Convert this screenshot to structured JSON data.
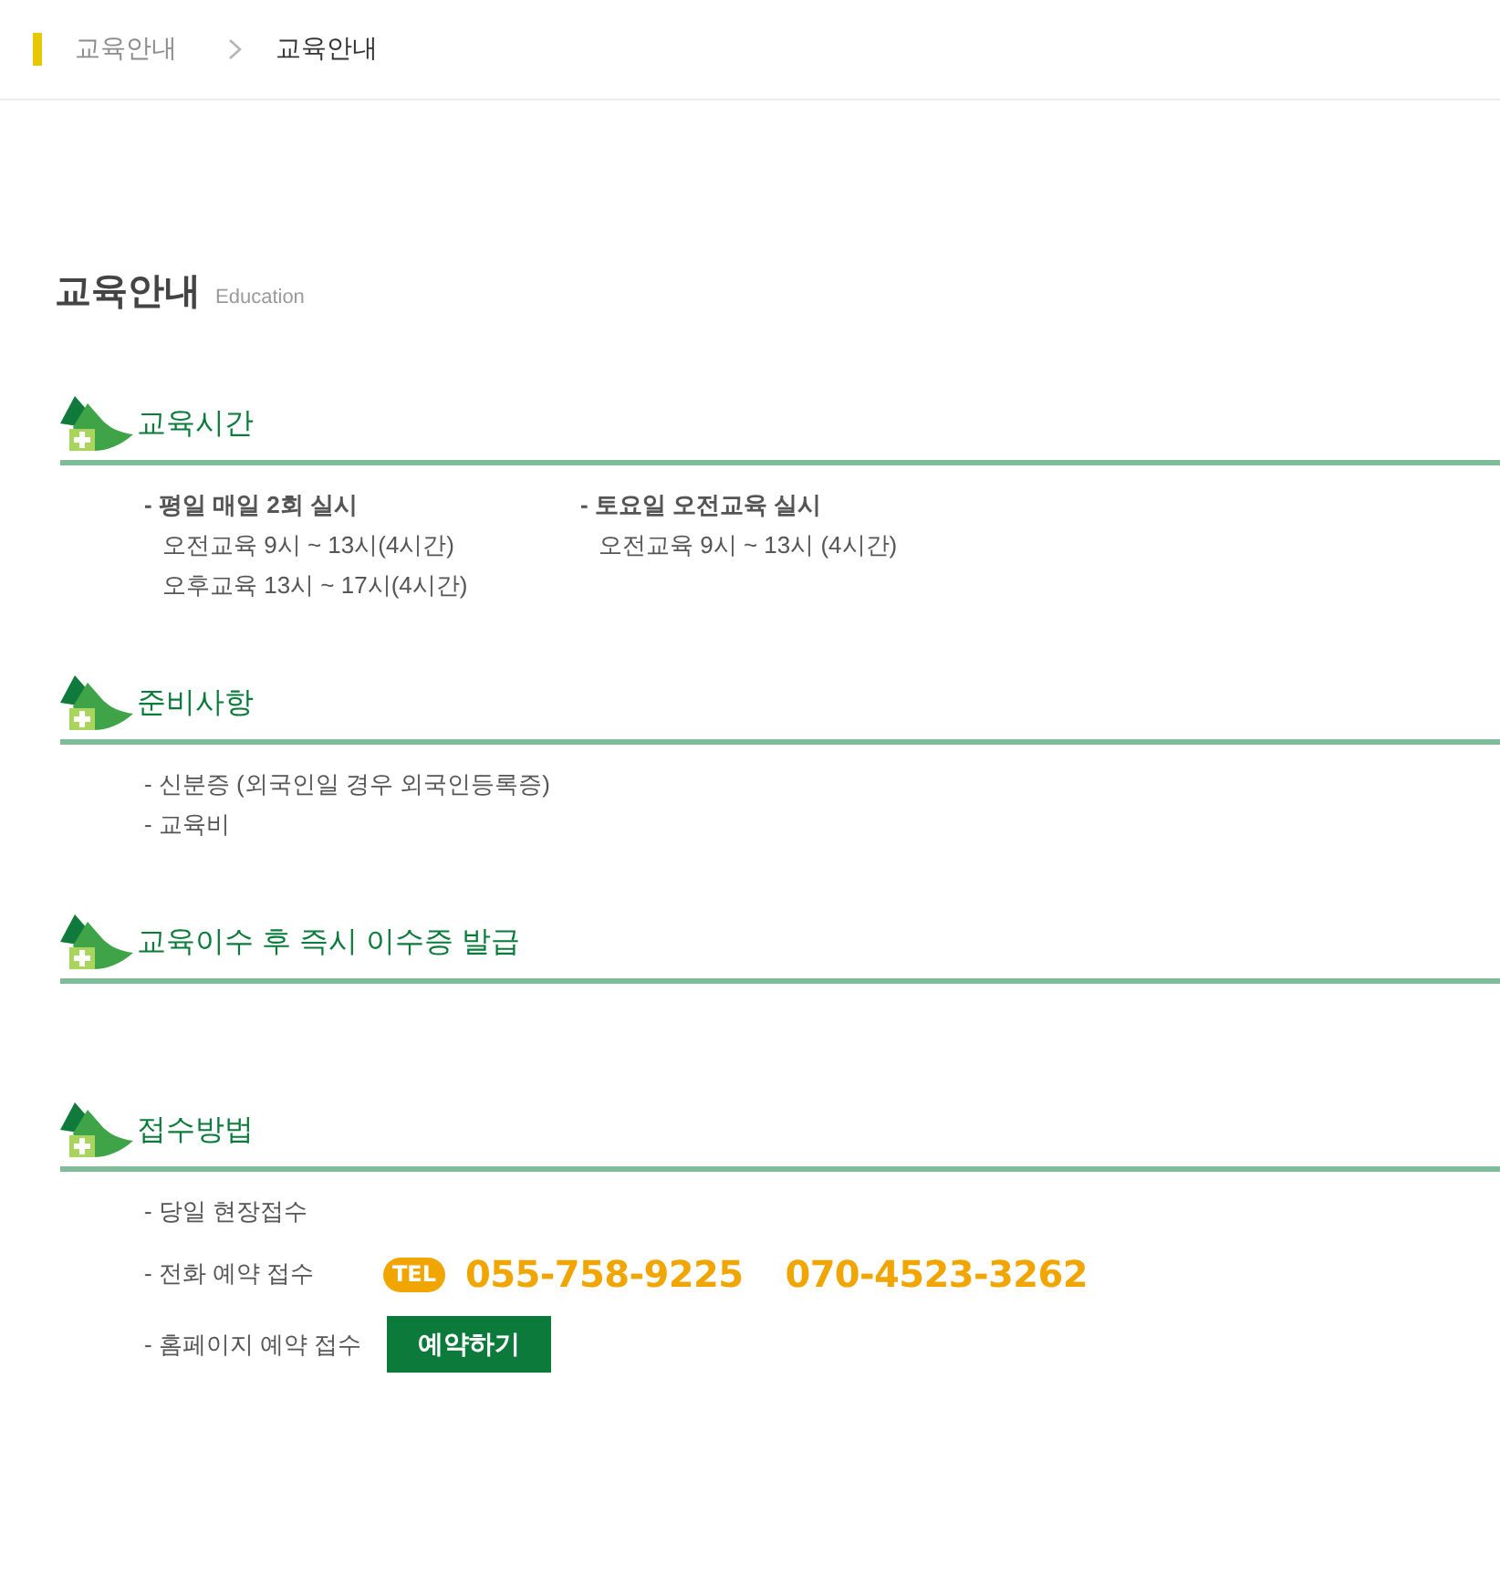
{
  "breadcrumb": {
    "items": [
      {
        "label": "교육안내",
        "current": false
      },
      {
        "label": "교육안내",
        "current": true
      }
    ]
  },
  "page_header": {
    "title": "교육안내",
    "subtitle": "Education"
  },
  "sections": [
    {
      "title": "교육시간",
      "columns": [
        {
          "items": [
            {
              "kind": "heading",
              "text": "- 평일 매일 2회 실시"
            },
            {
              "kind": "detail",
              "text": "오전교육 9시 ~ 13시(4시간)"
            },
            {
              "kind": "detail",
              "text": "오후교육 13시 ~ 17시(4시간)"
            }
          ]
        },
        {
          "items": [
            {
              "kind": "heading",
              "text": "- 토요일 오전교육 실시"
            },
            {
              "kind": "detail",
              "text": "오전교육 9시 ~ 13시 (4시간)"
            }
          ]
        }
      ]
    },
    {
      "title": "준비사항",
      "columns": [
        {
          "items": [
            {
              "kind": "line",
              "text": "- 신분증 (외국인일 경우 외국인등록증)"
            },
            {
              "kind": "line",
              "text": "- 교육비"
            }
          ]
        }
      ]
    },
    {
      "title": "교육이수 후 즉시 이수증 발급"
    },
    {
      "title": "접수방법",
      "columns": [
        {
          "items": [
            {
              "kind": "line",
              "text": "- 당일 현장접수"
            },
            {
              "kind": "phone",
              "text": "- 전화 예약 접수",
              "badge": "TEL",
              "numbers": [
                "055-758-9225",
                "070-4523-3262"
              ]
            },
            {
              "kind": "button",
              "text": "- 홈페이지 예약 접수",
              "button": "예약하기"
            }
          ]
        }
      ]
    }
  ]
}
